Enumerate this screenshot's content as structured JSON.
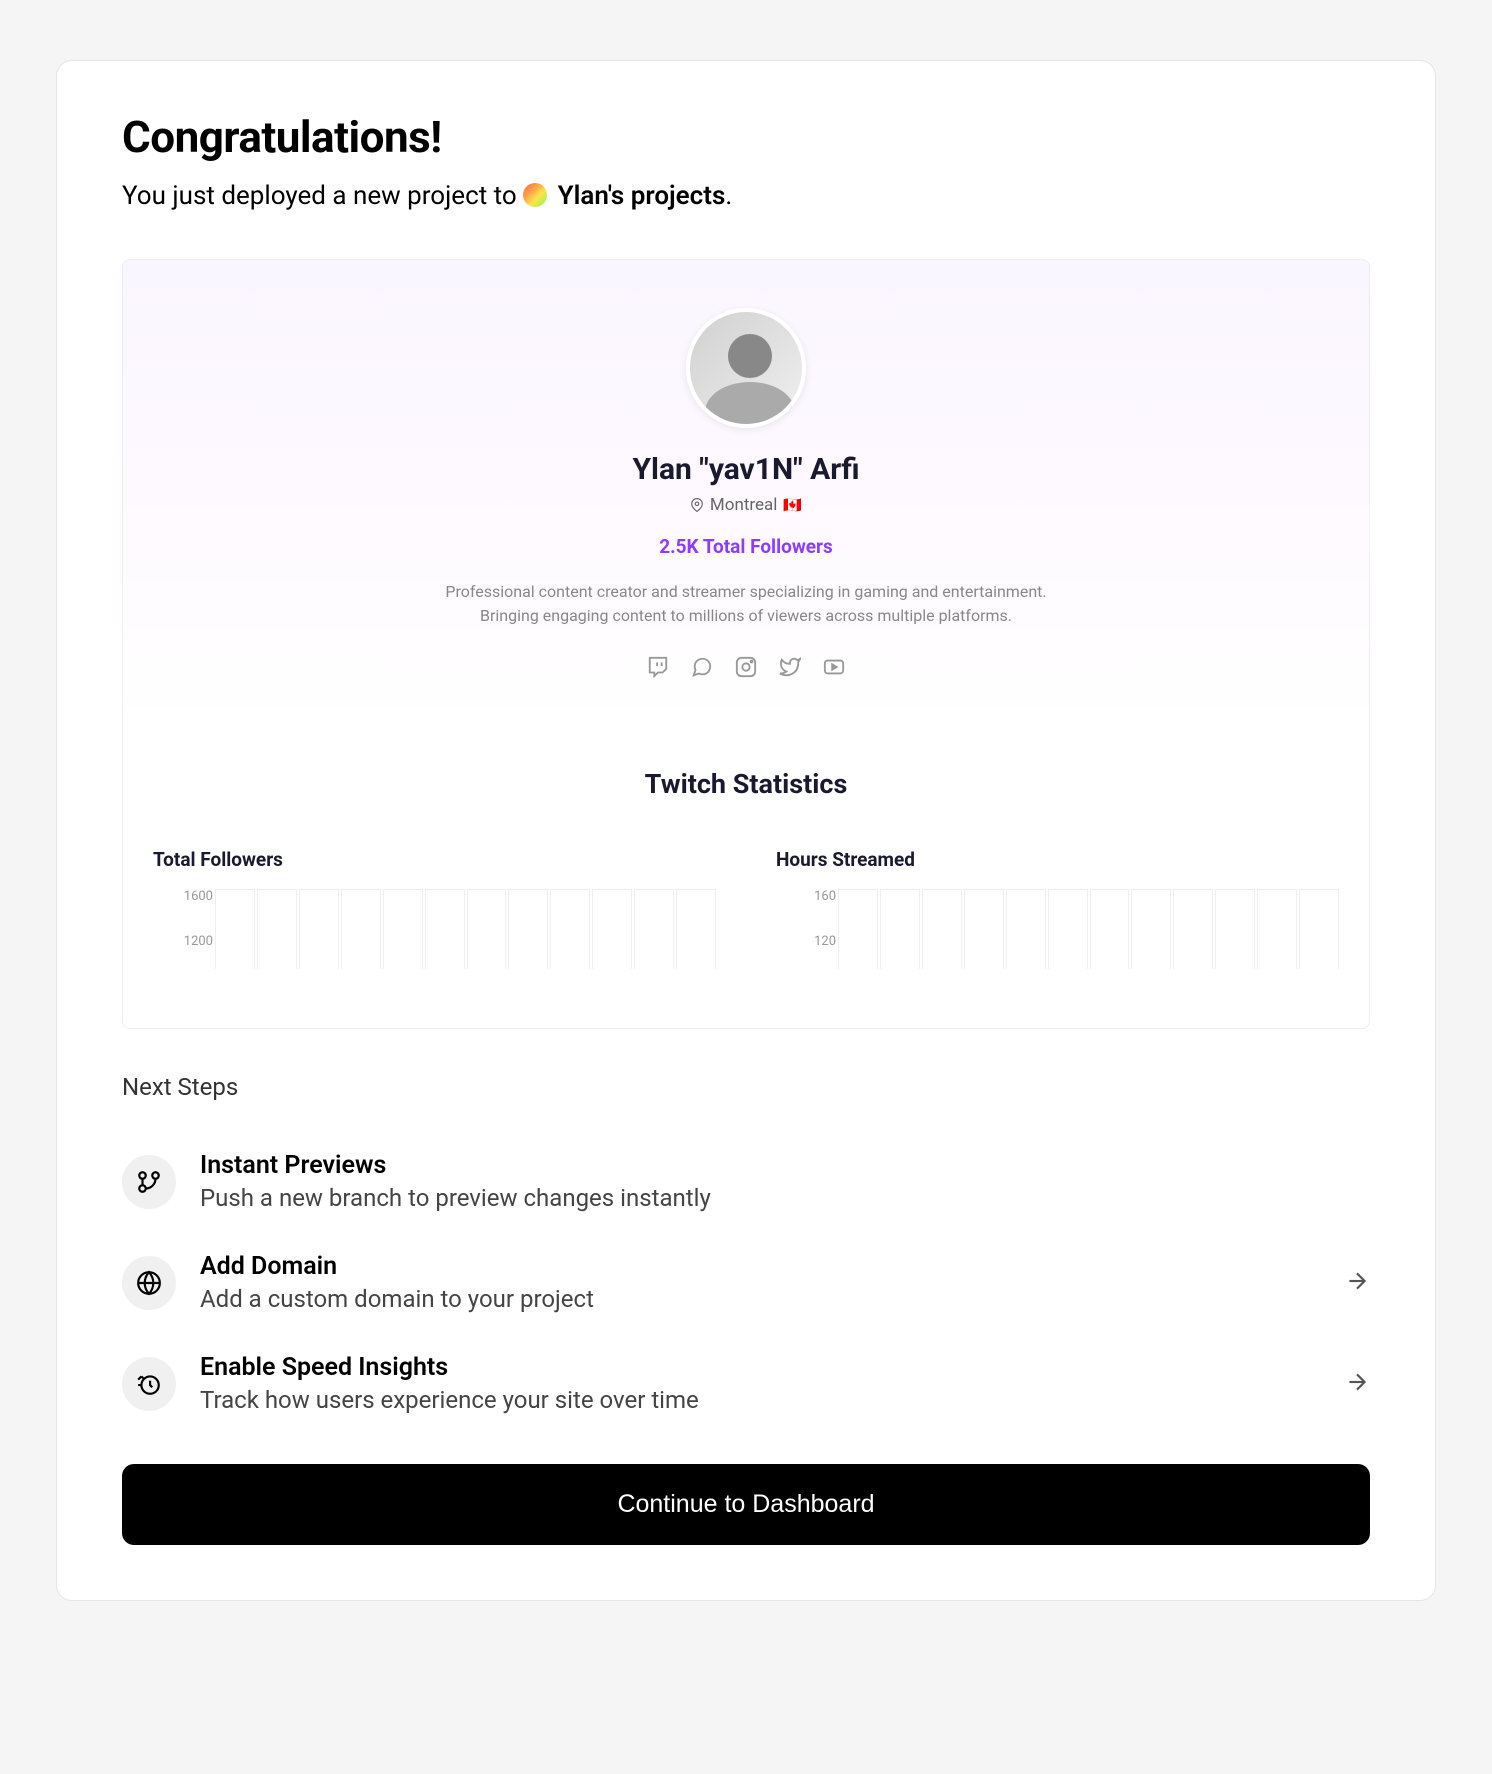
{
  "header": {
    "title": "Congratulations!",
    "subtitle_prefix": "You just deployed a new project to ",
    "team_name": "Ylan's projects",
    "subtitle_suffix": "."
  },
  "preview": {
    "profile_name": "Ylan \"yav1N\" Arfi",
    "location": "Montreal",
    "flag": "🇨🇦",
    "followers_stat": "2.5K Total Followers",
    "bio_line1": "Professional content creator and streamer specializing in gaming and entertainment.",
    "bio_line2": "Bringing engaging content to millions of viewers across multiple platforms.",
    "stats_heading": "Twitch Statistics",
    "stat_cards": [
      {
        "title": "Total Followers",
        "y_ticks": [
          "1600",
          "1200"
        ]
      },
      {
        "title": "Hours Streamed",
        "y_ticks": [
          "160",
          "120"
        ]
      }
    ]
  },
  "next_steps": {
    "label": "Next Steps",
    "items": [
      {
        "icon": "branch-icon",
        "title": "Instant Previews",
        "desc": "Push a new branch to preview changes instantly",
        "link": false
      },
      {
        "icon": "globe-icon",
        "title": "Add Domain",
        "desc": "Add a custom domain to your project",
        "link": true
      },
      {
        "icon": "speed-icon",
        "title": "Enable Speed Insights",
        "desc": "Track how users experience your site over time",
        "link": true
      }
    ]
  },
  "cta": {
    "label": "Continue to Dashboard"
  }
}
